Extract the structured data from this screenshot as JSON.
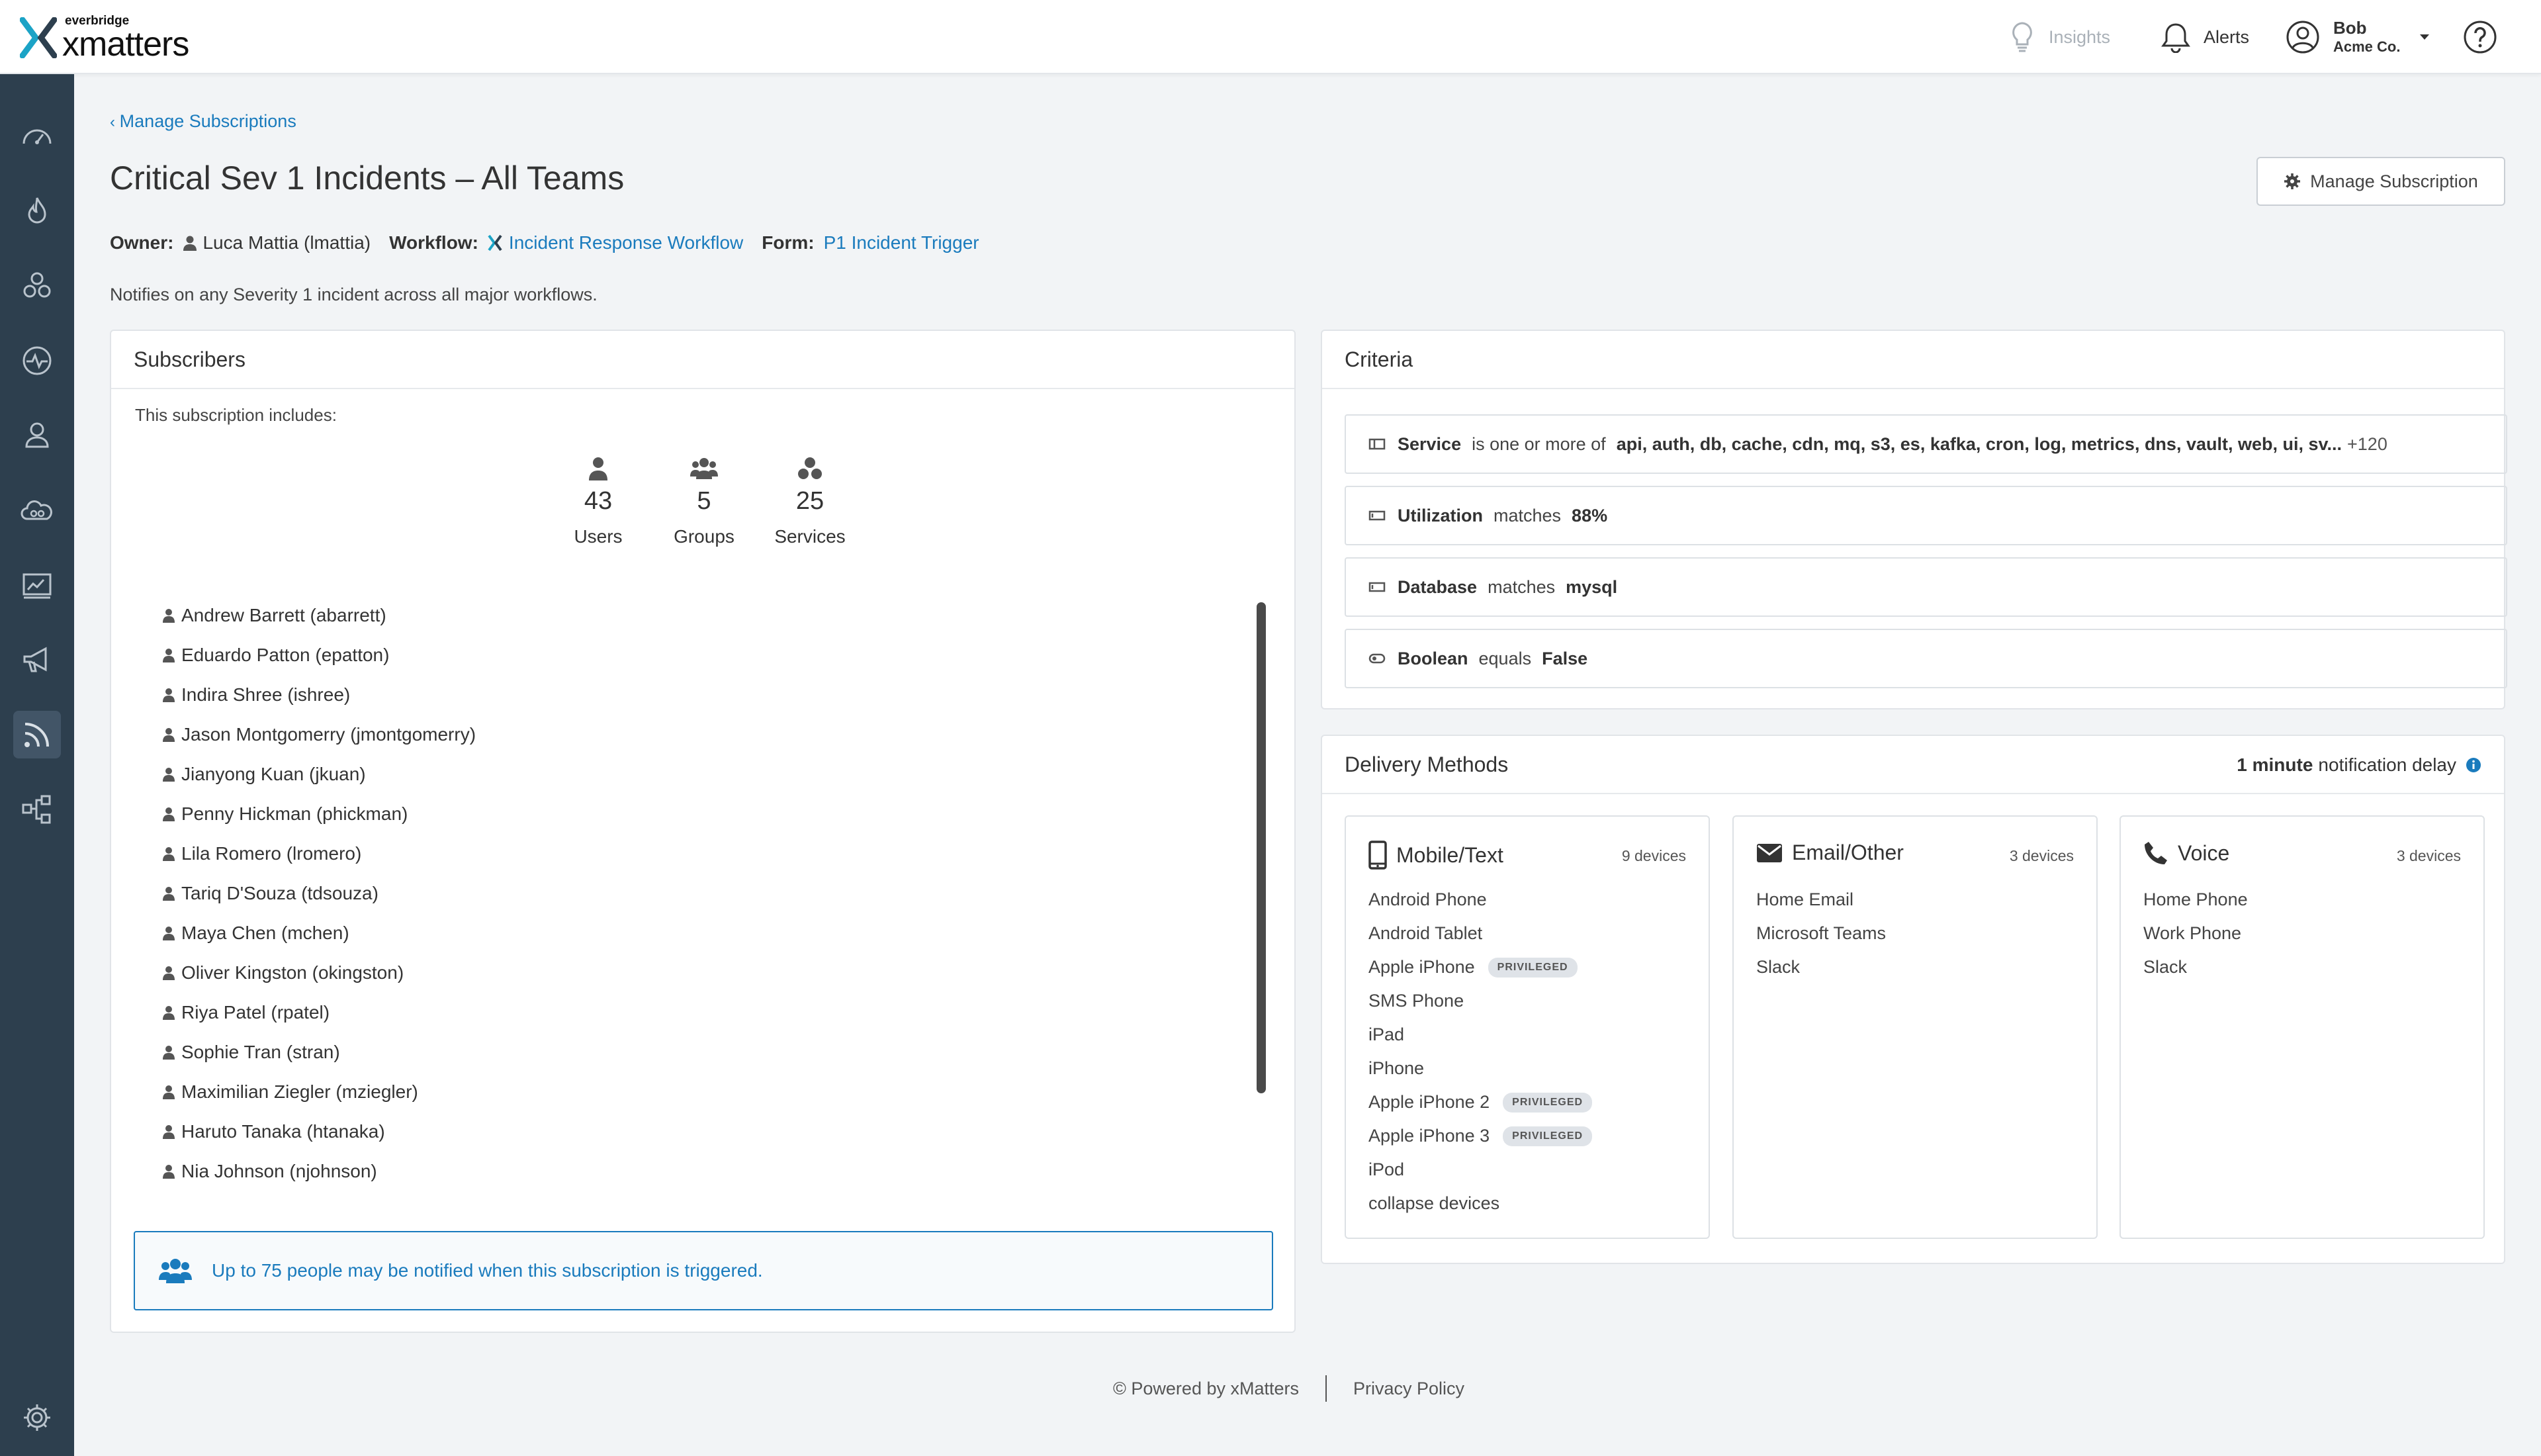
{
  "app": {
    "logo_sub": "everbridge",
    "logo_main": "xmatters"
  },
  "topnav": {
    "insights": "Insights",
    "alerts": "Alerts",
    "user_name": "Bob",
    "user_company": "Acme Co."
  },
  "sidebar": {
    "items": [
      "dashboard-icon",
      "incidents-icon",
      "groups-icon",
      "activity-icon",
      "users-icon",
      "services-icon",
      "reports-icon",
      "messaging-icon",
      "subscriptions-icon",
      "workflows-icon",
      "settings-icon"
    ],
    "active": "subscriptions-icon"
  },
  "header": {
    "breadcrumb": "Manage Subscriptions",
    "title": "Critical Sev 1 Incidents – All Teams",
    "owner_label": "Owner:",
    "owner_value": "Luca Mattia (lmattia)",
    "workflow_label": "Workflow:",
    "workflow_value": "Incident Response Workflow",
    "form_label": "Form:",
    "form_value": "P1 Incident Trigger",
    "description": "Notifies on any Severity 1 incident across all major workflows.",
    "manage_button": "Manage Subscription"
  },
  "subscribers": {
    "title": "Subscribers",
    "includes": "This subscription includes:",
    "stats": [
      {
        "value": "43",
        "label": "Users"
      },
      {
        "value": "5",
        "label": "Groups"
      },
      {
        "value": "25",
        "label": "Services"
      }
    ],
    "users": [
      "Andrew Barrett (abarrett)",
      "Eduardo Patton (epatton)",
      "Indira Shree (ishree)",
      "Jason Montgomerry (jmontgomerry)",
      "Jianyong Kuan (jkuan)",
      "Penny Hickman (phickman)",
      "Lila Romero (lromero)",
      "Tariq D'Souza (tdsouza)",
      "Maya Chen (mchen)",
      "Oliver Kingston (okingston)",
      "Riya Patel (rpatel)",
      "Sophie Tran (stran)",
      "Maximilian Ziegler (mziegler)",
      "Haruto Tanaka (htanaka)",
      "Nia Johnson (njohnson)"
    ],
    "notice": "Up to 75 people may be notified when this subscription is triggered."
  },
  "criteria": {
    "title": "Criteria",
    "items": [
      {
        "field": "Service",
        "operator": "is one or more of",
        "value": "api, auth, db, cache, cdn, mq, s3, es, kafka, cron, log, metrics, dns, vault, web, ui, sv...",
        "more": "+120"
      },
      {
        "field": "Utilization",
        "operator": "matches",
        "value": "88%",
        "more": ""
      },
      {
        "field": "Database",
        "operator": "matches",
        "value": "mysql",
        "more": ""
      },
      {
        "field": "Boolean",
        "operator": "equals",
        "value": "False",
        "more": ""
      }
    ]
  },
  "delivery": {
    "title": "Delivery Methods",
    "delay_value": "1 minute",
    "delay_text": "notification delay",
    "cards": [
      {
        "title": "Mobile/Text",
        "count": "9 devices",
        "devices": [
          {
            "name": "Android Phone",
            "badge": ""
          },
          {
            "name": "Android Tablet",
            "badge": ""
          },
          {
            "name": "Apple iPhone",
            "badge": "PRIVILEGED"
          },
          {
            "name": "SMS Phone",
            "badge": ""
          },
          {
            "name": "iPad",
            "badge": ""
          },
          {
            "name": "iPhone",
            "badge": ""
          },
          {
            "name": "Apple iPhone 2",
            "badge": "PRIVILEGED"
          },
          {
            "name": "Apple iPhone 3",
            "badge": "PRIVILEGED"
          },
          {
            "name": "iPod",
            "badge": ""
          }
        ],
        "collapse": "collapse devices"
      },
      {
        "title": "Email/Other",
        "count": "3 devices",
        "devices": [
          {
            "name": "Home Email",
            "badge": ""
          },
          {
            "name": "Microsoft Teams",
            "badge": ""
          },
          {
            "name": "Slack",
            "badge": ""
          }
        ]
      },
      {
        "title": "Voice",
        "count": "3 devices",
        "devices": [
          {
            "name": "Home Phone",
            "badge": ""
          },
          {
            "name": "Work Phone",
            "badge": ""
          },
          {
            "name": "Slack",
            "badge": ""
          }
        ]
      }
    ]
  },
  "footer": {
    "powered": "© Powered by xMatters",
    "privacy": "Privacy Policy"
  },
  "colors": {
    "accent": "#1a7bbd",
    "sidebar": "#2d3f4e",
    "logo_teal": "#1ba3c6"
  }
}
